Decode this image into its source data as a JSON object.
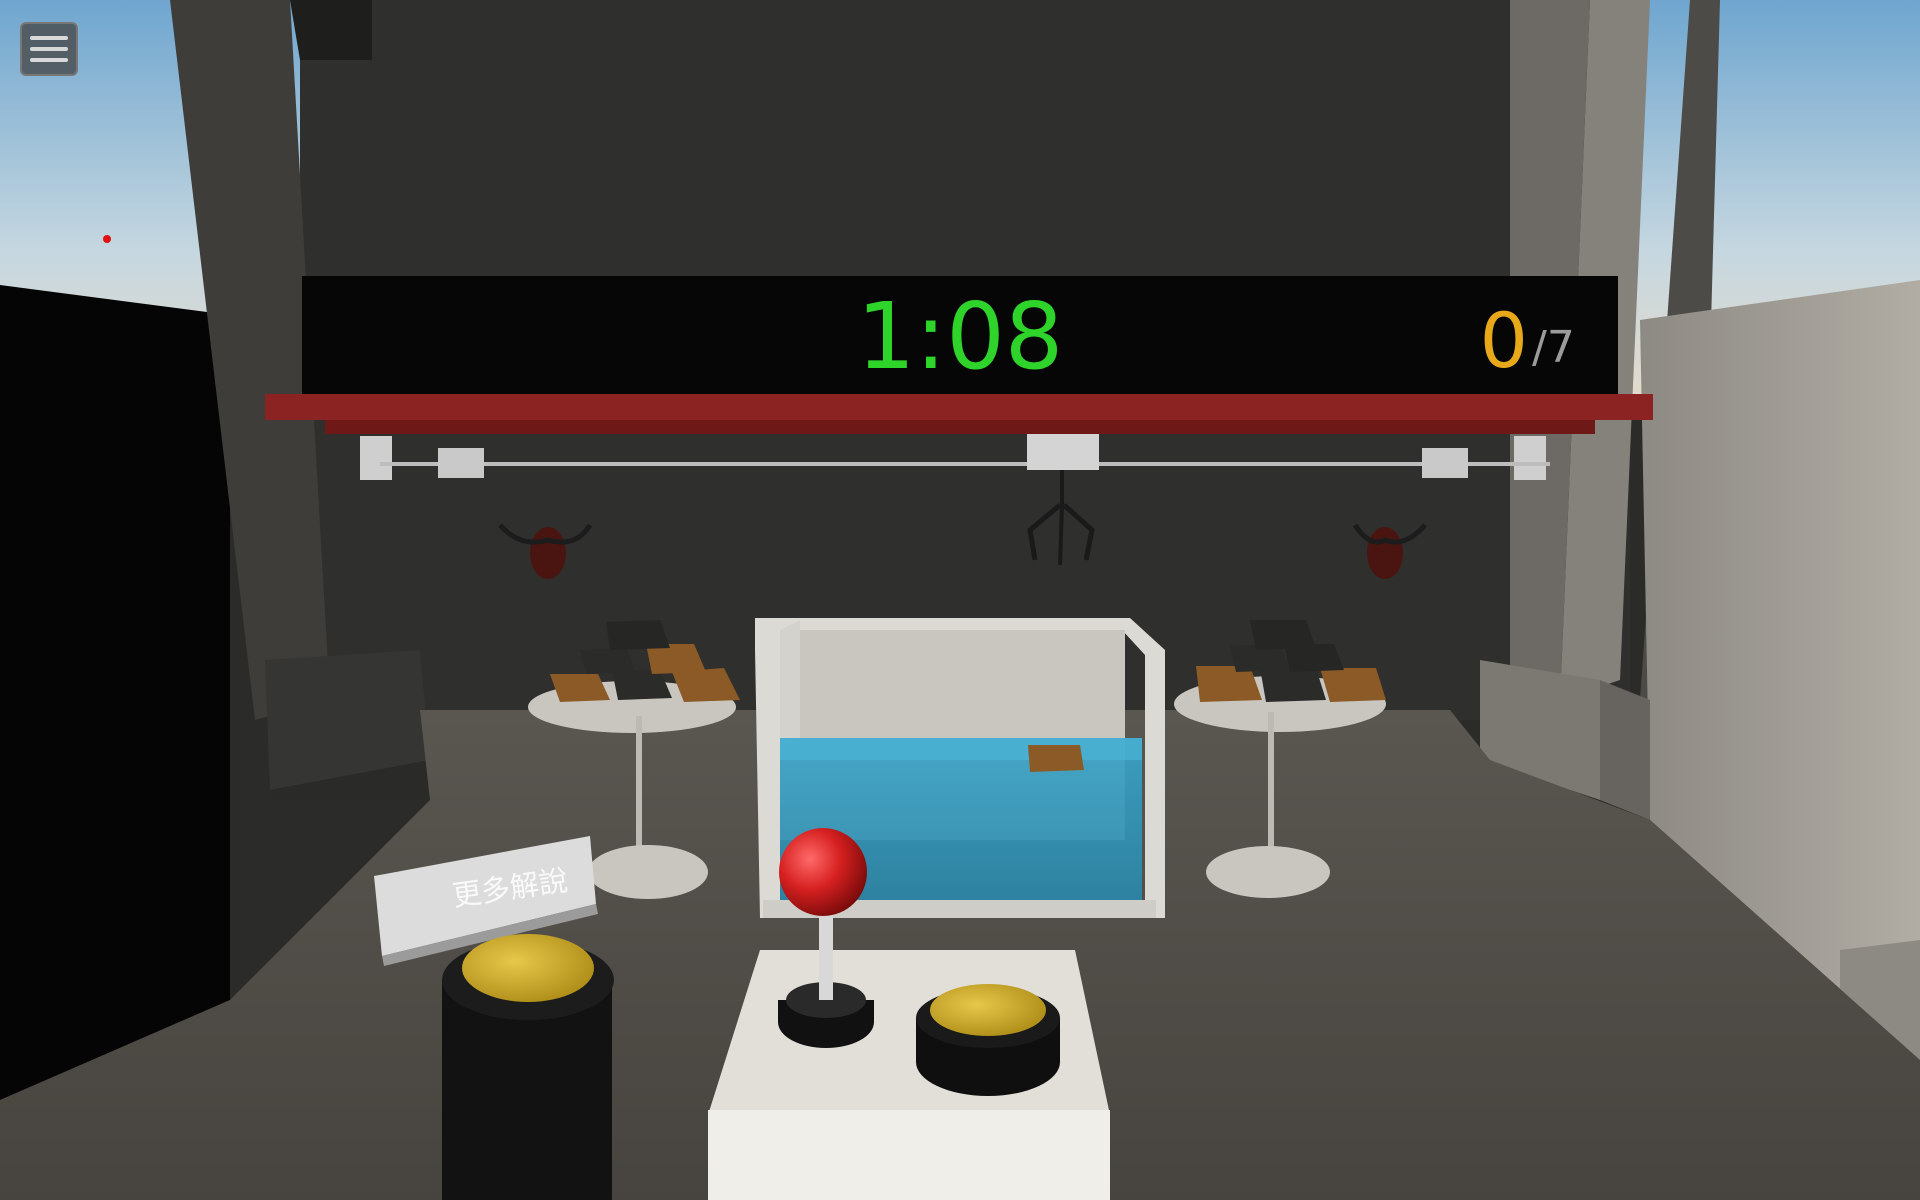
{
  "hud": {
    "timer": "1:08",
    "score_current": "0",
    "score_total": "/7"
  },
  "menu": {
    "icon": "hamburger-menu-icon"
  },
  "sign": {
    "label": "更多解說"
  },
  "colors": {
    "timer": "#2fd42a",
    "score_current": "#e7a91a",
    "score_total": "#9b9b9b",
    "hud_bar": "#8b2323",
    "water": "#3aa0c4",
    "joystick_ball": "#d62020",
    "buttons": "#c9a521"
  }
}
